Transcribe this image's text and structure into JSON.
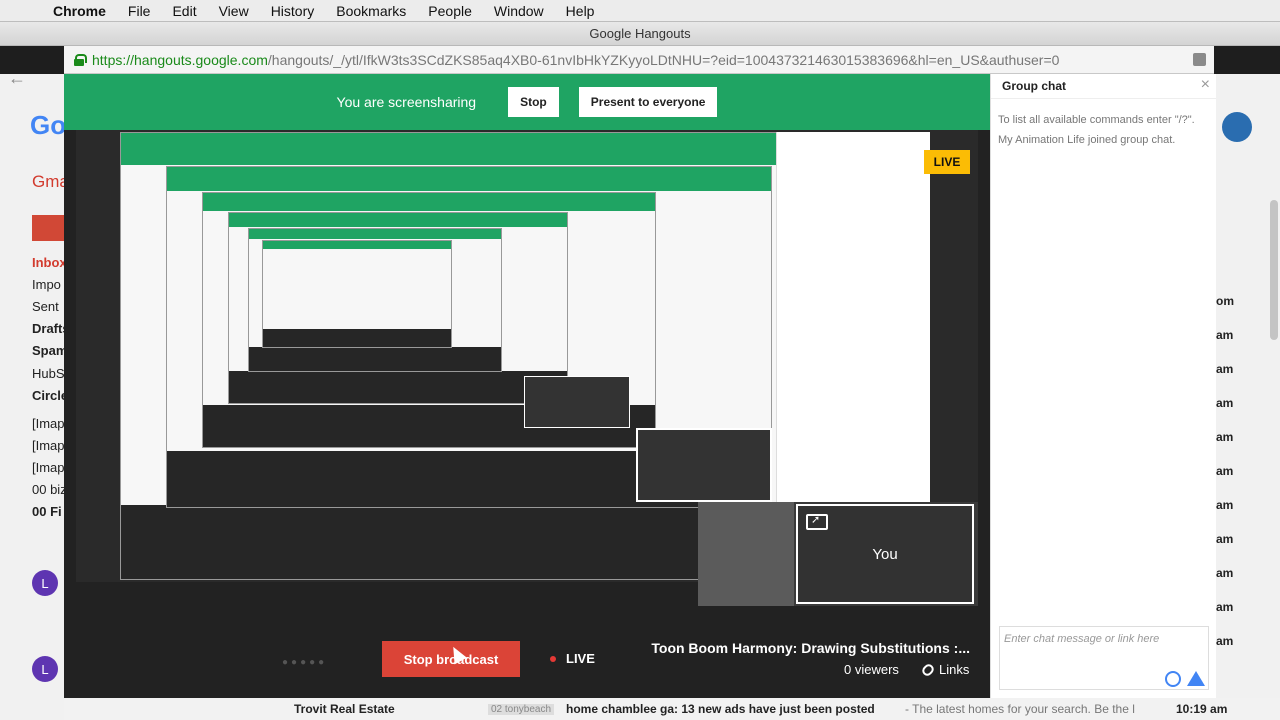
{
  "menubar": {
    "items": [
      "Chrome",
      "File",
      "Edit",
      "View",
      "History",
      "Bookmarks",
      "People",
      "Window",
      "Help"
    ]
  },
  "window": {
    "title": "Google Hangouts"
  },
  "address": {
    "host": "https://hangouts.google.com",
    "path": "/hangouts/_/ytl/IfkW3ts3SCdZKS85aq4XB0-61nvIbHkYZKyyoLDtNHU=?eid=100437321463015383696&hl=en_US&authuser=0"
  },
  "background_gmail": {
    "logo": "Go",
    "label": "Gma",
    "nav": [
      "Inbox",
      "Impo",
      "Sent",
      "Drafts",
      "Spam",
      "HubS",
      "Circle",
      "[Imap",
      "[Imap",
      "[Imap",
      "00 biz",
      "00 Fi"
    ],
    "times": [
      "om",
      "am",
      "am",
      "am",
      "am",
      "am",
      "am",
      "am",
      "am",
      "am",
      "am"
    ]
  },
  "screenshare_bar": {
    "status": "You are screensharing",
    "stop_label": "Stop",
    "present_label": "Present to everyone"
  },
  "self_view": {
    "label": "You"
  },
  "broadcast": {
    "stop_label": "Stop broadcast",
    "live_label": "LIVE",
    "title": "Toon Boom Harmony: Drawing Substitutions :...",
    "viewers": "0 viewers",
    "links_label": "Links"
  },
  "group_chat": {
    "title": "Group chat",
    "close": "×",
    "messages": [
      "To list all available commands enter \"/?\".",
      "My Animation Life joined group chat."
    ],
    "input_placeholder": "Enter chat message or link here",
    "live_badge": "LIVE"
  },
  "gmail_row": {
    "sender": "Trovit Real Estate",
    "tag": "02 tonybeach",
    "subject": "home chamblee ga: 13 new ads have just been posted",
    "snippet": " - The latest homes for your search. Be the l",
    "time": "10:19 am"
  },
  "colors": {
    "hangouts_green": "#1fa463",
    "broadcast_red": "#db4437",
    "live_yellow": "#fbbc05"
  }
}
